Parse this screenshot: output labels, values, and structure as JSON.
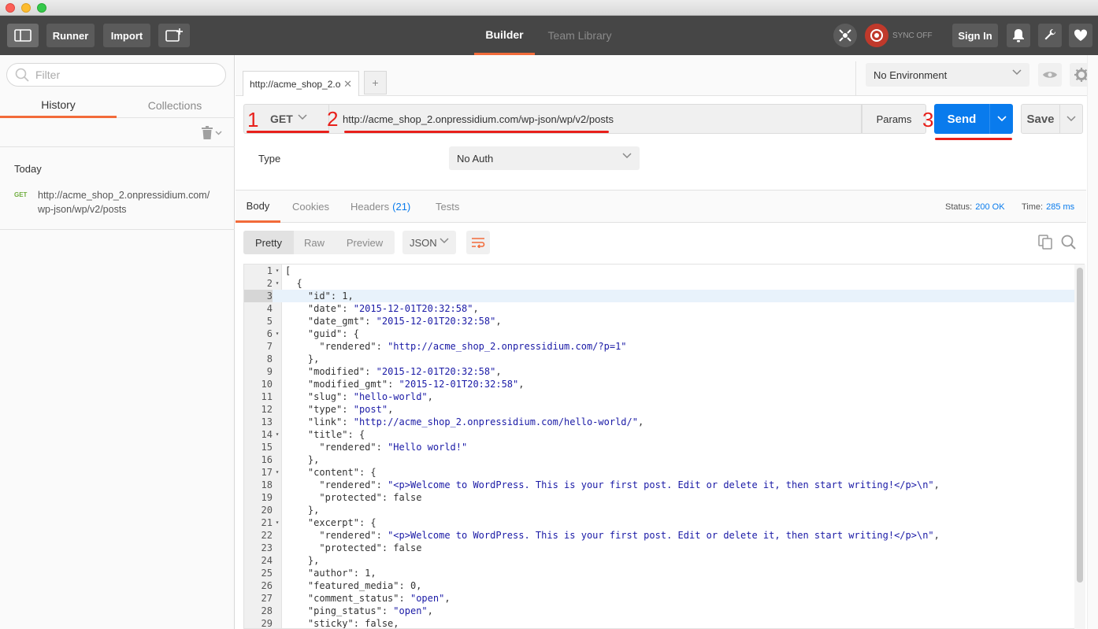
{
  "header": {
    "runner": "Runner",
    "import": "Import",
    "tab_builder": "Builder",
    "tab_team_library": "Team Library",
    "sync": "SYNC OFF",
    "sign_in": "Sign In"
  },
  "sidebar": {
    "filter_placeholder": "Filter",
    "tab_history": "History",
    "tab_collections": "Collections",
    "group_today": "Today",
    "history_items": [
      {
        "method": "GET",
        "url": "http://acme_shop_2.onpressidium.com/wp-json/wp/v2/posts"
      }
    ]
  },
  "request": {
    "tab_title": "http://acme_shop_2.o",
    "environment": "No Environment",
    "method": "GET",
    "url": "http://acme_shop_2.onpressidium.com/wp-json/wp/v2/posts",
    "params": "Params",
    "send": "Send",
    "save": "Save",
    "auth_type_label": "Type",
    "auth_type": "No Auth"
  },
  "annotations": {
    "n1": "1",
    "n2": "2",
    "n3": "3"
  },
  "response": {
    "tab_body": "Body",
    "tab_cookies": "Cookies",
    "tab_headers": "Headers",
    "headers_count": "(21)",
    "tab_tests": "Tests",
    "status_label": "Status:",
    "status_value": "200 OK",
    "time_label": "Time:",
    "time_value": "285 ms",
    "view_pretty": "Pretty",
    "view_raw": "Raw",
    "view_preview": "Preview",
    "format": "JSON",
    "active_line": 3,
    "lines": [
      {
        "n": 1,
        "fold": true,
        "t": "["
      },
      {
        "n": 2,
        "fold": true,
        "t": "  {"
      },
      {
        "n": 3,
        "fold": false,
        "t": "    \"id\": 1,"
      },
      {
        "n": 4,
        "fold": false,
        "t": "    \"date\": \"2015-12-01T20:32:58\","
      },
      {
        "n": 5,
        "fold": false,
        "t": "    \"date_gmt\": \"2015-12-01T20:32:58\","
      },
      {
        "n": 6,
        "fold": true,
        "t": "    \"guid\": {"
      },
      {
        "n": 7,
        "fold": false,
        "t": "      \"rendered\": \"http://acme_shop_2.onpressidium.com/?p=1\""
      },
      {
        "n": 8,
        "fold": false,
        "t": "    },"
      },
      {
        "n": 9,
        "fold": false,
        "t": "    \"modified\": \"2015-12-01T20:32:58\","
      },
      {
        "n": 10,
        "fold": false,
        "t": "    \"modified_gmt\": \"2015-12-01T20:32:58\","
      },
      {
        "n": 11,
        "fold": false,
        "t": "    \"slug\": \"hello-world\","
      },
      {
        "n": 12,
        "fold": false,
        "t": "    \"type\": \"post\","
      },
      {
        "n": 13,
        "fold": false,
        "t": "    \"link\": \"http://acme_shop_2.onpressidium.com/hello-world/\","
      },
      {
        "n": 14,
        "fold": true,
        "t": "    \"title\": {"
      },
      {
        "n": 15,
        "fold": false,
        "t": "      \"rendered\": \"Hello world!\""
      },
      {
        "n": 16,
        "fold": false,
        "t": "    },"
      },
      {
        "n": 17,
        "fold": true,
        "t": "    \"content\": {"
      },
      {
        "n": 18,
        "fold": false,
        "t": "      \"rendered\": \"<p>Welcome to WordPress. This is your first post. Edit or delete it, then start writing!</p>\\n\","
      },
      {
        "n": 19,
        "fold": false,
        "t": "      \"protected\": false"
      },
      {
        "n": 20,
        "fold": false,
        "t": "    },"
      },
      {
        "n": 21,
        "fold": true,
        "t": "    \"excerpt\": {"
      },
      {
        "n": 22,
        "fold": false,
        "t": "      \"rendered\": \"<p>Welcome to WordPress. This is your first post. Edit or delete it, then start writing!</p>\\n\","
      },
      {
        "n": 23,
        "fold": false,
        "t": "      \"protected\": false"
      },
      {
        "n": 24,
        "fold": false,
        "t": "    },"
      },
      {
        "n": 25,
        "fold": false,
        "t": "    \"author\": 1,"
      },
      {
        "n": 26,
        "fold": false,
        "t": "    \"featured_media\": 0,"
      },
      {
        "n": 27,
        "fold": false,
        "t": "    \"comment_status\": \"open\","
      },
      {
        "n": 28,
        "fold": false,
        "t": "    \"ping_status\": \"open\","
      },
      {
        "n": 29,
        "fold": false,
        "t": "    \"sticky\": false,"
      }
    ]
  },
  "colors": {
    "accent": "#f26b3a",
    "send_blue": "#097bed",
    "annotation_red": "#e8201b",
    "get_green": "#6fad3d"
  }
}
